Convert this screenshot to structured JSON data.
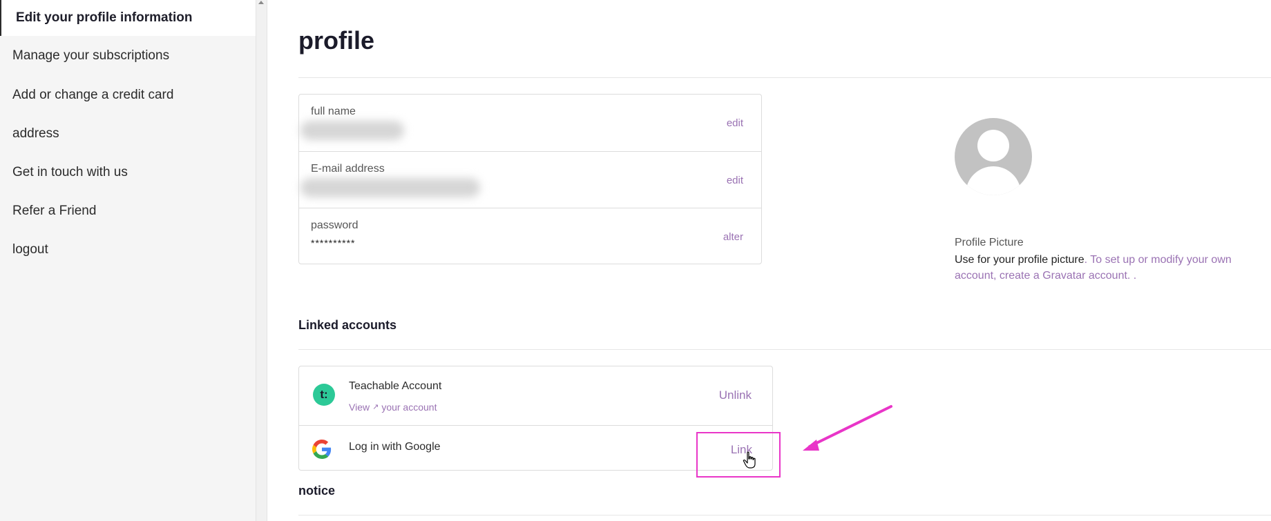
{
  "sidebar": {
    "items": [
      {
        "label": "Edit your profile information",
        "active": true
      },
      {
        "label": "Manage your subscriptions"
      },
      {
        "label": "Add or change a credit card"
      },
      {
        "label": "address"
      },
      {
        "label": "Get in touch with us"
      },
      {
        "label": "Refer a Friend"
      },
      {
        "label": "logout"
      }
    ]
  },
  "page": {
    "title": "profile"
  },
  "profile": {
    "fields": [
      {
        "label": "full name",
        "value": "",
        "action": "edit"
      },
      {
        "label": "E-mail address",
        "value": "",
        "action": "edit"
      },
      {
        "label": "password",
        "value": "**********",
        "action": "alter"
      }
    ],
    "picture": {
      "title": "Profile Picture",
      "desc_text": "Use for your profile picture",
      "desc_link": ". To set up or modify your own account, create a Gravatar account. ."
    }
  },
  "linked": {
    "title": "Linked accounts",
    "teachable": {
      "name": "Teachable Account",
      "logo_text": "t:",
      "view_label": "View",
      "your_account_label": "your account",
      "action": "Unlink"
    },
    "google": {
      "name": "Log in with Google",
      "action": "Link"
    }
  },
  "notice": {
    "title": "notice"
  },
  "colors": {
    "link": "#9a72b3",
    "annotation": "#e935c8",
    "teachable": "#2cc997"
  },
  "icons": {
    "external": "external-link-icon",
    "google": "google-icon",
    "cursor": "hand-cursor-icon",
    "arrow": "annotation-arrow"
  }
}
